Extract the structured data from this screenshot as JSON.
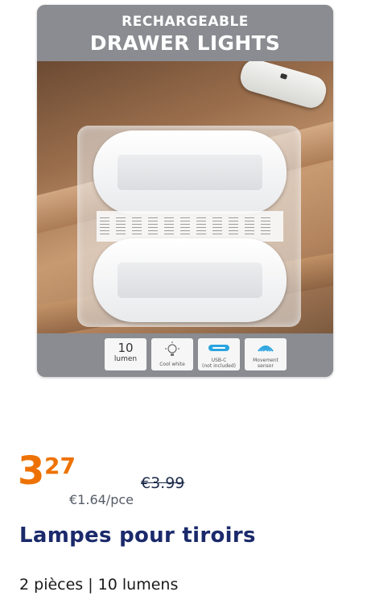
{
  "product_image": {
    "subtitle": "RECHARGEABLE",
    "headline": "DRAWER LIGHTS",
    "badges": [
      {
        "big": "10",
        "small": "lumen"
      },
      {
        "icon": "bulb-icon",
        "small": "Cool white"
      },
      {
        "icon": "usb-c-icon",
        "small": "USB-C",
        "tiny": "(not included)"
      },
      {
        "icon": "motion-sensor-icon",
        "small": "Movement",
        "tiny": "sensor"
      }
    ]
  },
  "price": {
    "integer": "3",
    "decimals": "27",
    "old": "€3.99",
    "per_unit": "€1.64/pce",
    "accent_color": "#ee7203"
  },
  "product": {
    "name": "Lampes pour tiroirs",
    "details": "2 pièces | 10 lumens"
  }
}
